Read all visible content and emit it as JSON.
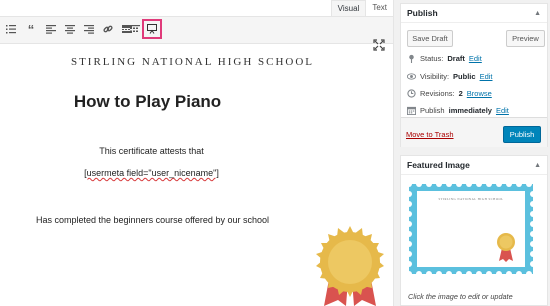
{
  "editor": {
    "tabs": [
      "Visual",
      "Text"
    ],
    "toolbar_icons": [
      "list-icon",
      "blockquote-icon",
      "align-left-icon",
      "align-center-icon",
      "align-right-icon",
      "link-icon",
      "read-more-icon",
      "toolbar-toggle-icon",
      "certificate-preview-icon"
    ],
    "content": {
      "school": "STIRLING NATIONAL HIGH SCHOOL",
      "title": "How to Play Piano",
      "attests": "This certificate attests that",
      "shortcode": "[usermeta field=\"user_nicename\"]",
      "completed": "Has completed the beginners course offered by our school"
    }
  },
  "publish": {
    "heading": "Publish",
    "save_draft": "Save Draft",
    "preview": "Preview",
    "status_label": "Status:",
    "status_value": "Draft",
    "visibility_label": "Visibility:",
    "visibility_value": "Public",
    "revisions_label": "Revisions:",
    "revisions_value": "2",
    "browse": "Browse",
    "publish_label": "Publish",
    "publish_value": "immediately",
    "edit": "Edit",
    "move_to_trash": "Move to Trash",
    "publish_button": "Publish"
  },
  "featured": {
    "heading": "Featured Image",
    "thumb_school": "STIRLING NATIONAL HIGH SCHOOL",
    "caption": "Click the image to edit or update"
  },
  "colors": {
    "highlight": "#e03a7a",
    "primary": "#0085ba",
    "link": "#0073aa",
    "trash": "#a00000",
    "frame": "#5bc0de",
    "seal": "#e6b94a",
    "ribbon": "#d9534f"
  }
}
